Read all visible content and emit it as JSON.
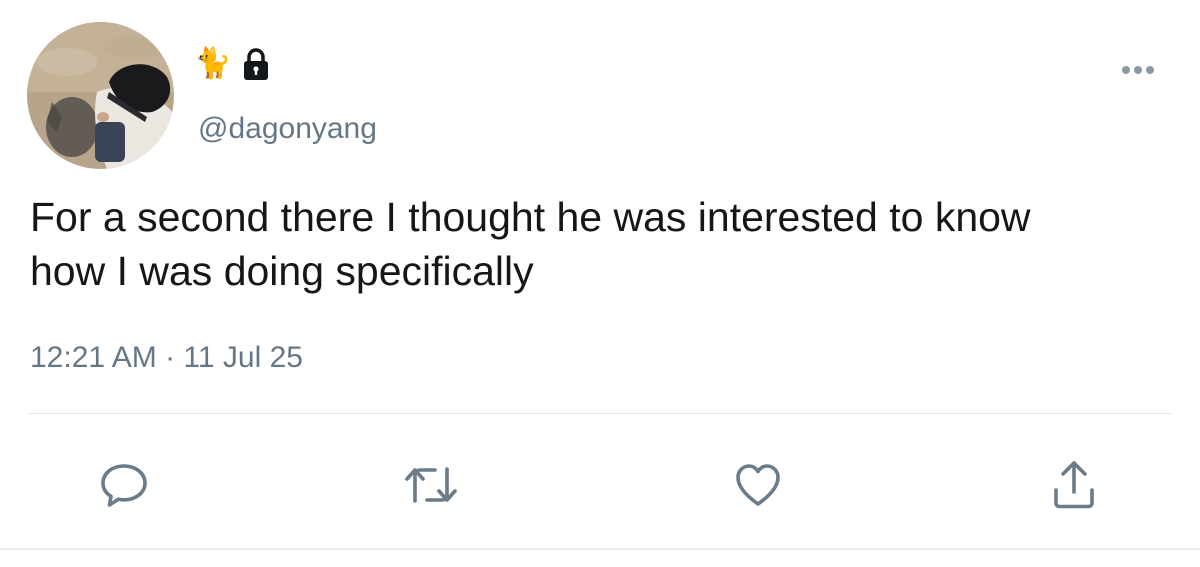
{
  "tweet": {
    "display_name_emoji": "🐈",
    "lock_icon": "lock-icon",
    "handle": "@dagonyang",
    "text": "For a second there I thought he was interested to know\nhow I was doing specifically",
    "timestamp": "12:21 AM · 11 Jul 25",
    "more_icon": "more-options-icon"
  },
  "actions": {
    "reply_icon": "reply-icon",
    "retweet_icon": "retweet-icon",
    "like_icon": "heart-icon",
    "share_icon": "share-icon"
  },
  "colors": {
    "text": "#14171a",
    "secondary": "#657786",
    "action_icon": "#6a7b89",
    "divider": "#e1e8ed"
  }
}
